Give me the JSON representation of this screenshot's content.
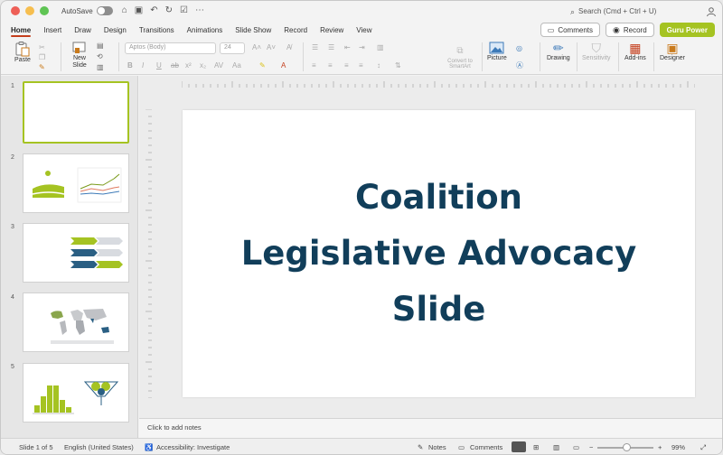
{
  "titlebar": {
    "autosave_label": "AutoSave",
    "search_placeholder": "Search (Cmd + Ctrl + U)"
  },
  "tabs": [
    "Home",
    "Insert",
    "Draw",
    "Design",
    "Transitions",
    "Animations",
    "Slide Show",
    "Record",
    "Review",
    "View"
  ],
  "tab_actions": {
    "comments_label": "Comments",
    "record_label": "Record",
    "guru_label": "Guru Power"
  },
  "ribbon": {
    "paste_label": "Paste",
    "new_slide_label": "New\nSlide",
    "font_name": "Aptos (Body)",
    "font_size": "24",
    "convert_smartart_label": "Convert to SmartArt",
    "picture_label": "Picture",
    "drawing_label": "Drawing",
    "sensitivity_label": "Sensitivity",
    "addins_label": "Add-ins",
    "designer_label": "Designer"
  },
  "slides": [
    {
      "num": "1",
      "kind": "title",
      "selected": true
    },
    {
      "num": "2",
      "kind": "line-chart"
    },
    {
      "num": "3",
      "kind": "arrows"
    },
    {
      "num": "4",
      "kind": "map"
    },
    {
      "num": "5",
      "kind": "histogram"
    }
  ],
  "current_slide": {
    "lines": [
      "Coalition",
      "Legislative Advocacy",
      "Slide"
    ]
  },
  "notes_placeholder": "Click to add notes",
  "status": {
    "slide_counter": "Slide 1 of 5",
    "language": "English (United States)",
    "accessibility": "Accessibility: Investigate",
    "notes_label": "Notes",
    "comments_label": "Comments",
    "zoom": "99%"
  },
  "colors": {
    "accent_green": "#a5c322",
    "title_navy": "#113e5a",
    "tab_underline": "#c43e1c"
  }
}
